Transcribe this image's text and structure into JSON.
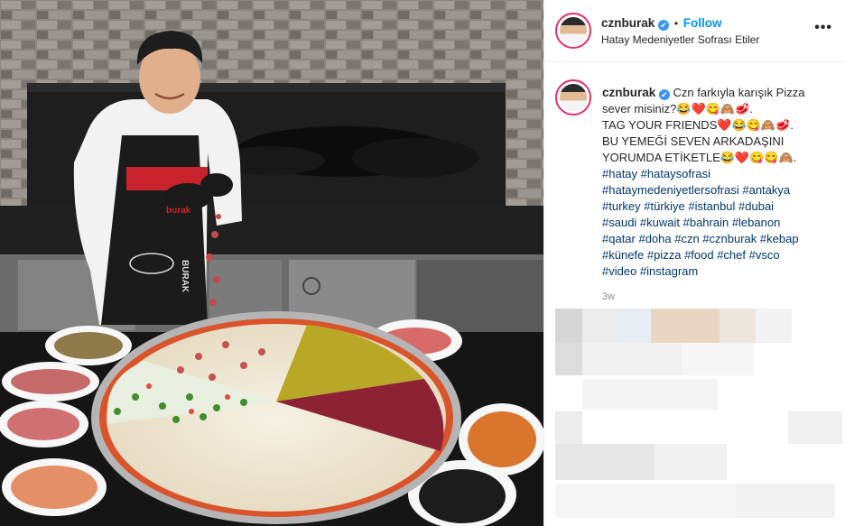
{
  "post": {
    "username": "cznburak",
    "follow_label": "Follow",
    "location": "Hatay Medeniyetler Sofrası Etiler",
    "more_label": "•••",
    "verified_mark": "✔",
    "dot": "•"
  },
  "caption": {
    "username": "cznburak",
    "line1": "Czn farkıyla karışık Pizza",
    "line2": "sever misiniz?😂❤️😋🙈🥩.",
    "line3": "TAG YOUR FRIENDS❤️😂😋🙈🥩.",
    "line4": "BU YEMEĞİ SEVEN ARKADAŞINI",
    "line5": "YORUMDA ETİKETLE😂❤️😋😋🙈.",
    "hashtags": [
      "#hatay #hataysofrasi",
      "#hataymedeniyetlersofrasi #antakya",
      "#turkey #türkiye #istanbul #dubai",
      "#saudi #kuwait #bahrain #lebanon",
      "#qatar #doha #czn #cznburak #kebap",
      "#künefe #pizza #food #chef #vsco",
      "#video #instagram"
    ]
  },
  "time_ago": "3w",
  "media": {
    "apron_text": "BURAK",
    "banner_text": "burak",
    "alt_icon": "pizza-video"
  },
  "colors": {
    "accent": "#0095f6",
    "hashtag": "#00376b",
    "story_ring": "#e1306c"
  }
}
